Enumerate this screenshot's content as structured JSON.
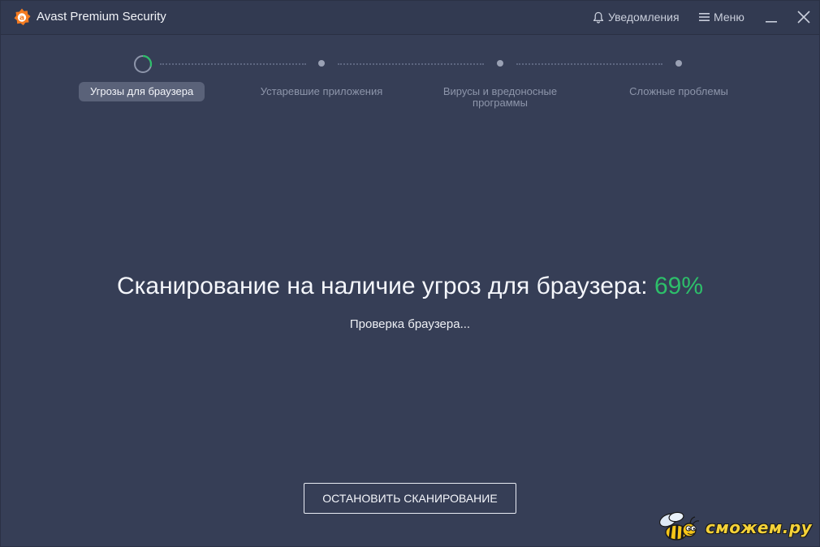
{
  "window": {
    "title": "Avast Premium Security",
    "notifications_label": "Уведомления",
    "menu_label": "Меню"
  },
  "stepper": {
    "steps": [
      {
        "label": "Угрозы для браузера",
        "state": "active"
      },
      {
        "label": "Устаревшие приложения",
        "state": "pending"
      },
      {
        "label": "Вирусы и вредоносные программы",
        "state": "pending"
      },
      {
        "label": "Сложные проблемы",
        "state": "pending"
      }
    ]
  },
  "scan": {
    "title": "Сканирование на наличие угроз для браузера:",
    "percent": "69%",
    "progress": 0.69,
    "status": "Проверка браузера..."
  },
  "actions": {
    "stop_label": "ОСТАНОВИТЬ СКАНИРОВАНИЕ"
  },
  "watermark": {
    "text": "сможем.ру"
  },
  "colors": {
    "background": "#363e56",
    "accent_green": "#2dbf6a",
    "logo_orange": "#f47b20"
  }
}
